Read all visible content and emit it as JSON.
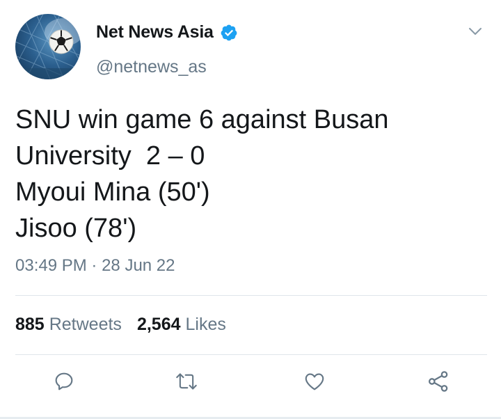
{
  "tweet": {
    "display_name": "Net News Asia",
    "handle": "@netnews_as",
    "text_lines": [
      "SNU win game 6 against Busan",
      "University  2 – 0",
      "Myoui Mina (50')",
      "Jisoo (78')"
    ],
    "time": "03:49 PM",
    "separator": "·",
    "date": "28 Jun 22",
    "retweets_count": "885",
    "retweets_label": "Retweets",
    "likes_count": "2,564",
    "likes_label": "Likes"
  },
  "icons": {
    "avatar": "soccer-ball-avatar",
    "verified": "verified-badge-icon",
    "menu": "chevron-down-icon",
    "reply": "reply-icon",
    "retweet": "retweet-icon",
    "like": "heart-icon",
    "share": "share-icon"
  },
  "colors": {
    "text": "#14171a",
    "secondary": "#657786",
    "verified": "#1da1f2",
    "divider": "#dfe5ea"
  }
}
